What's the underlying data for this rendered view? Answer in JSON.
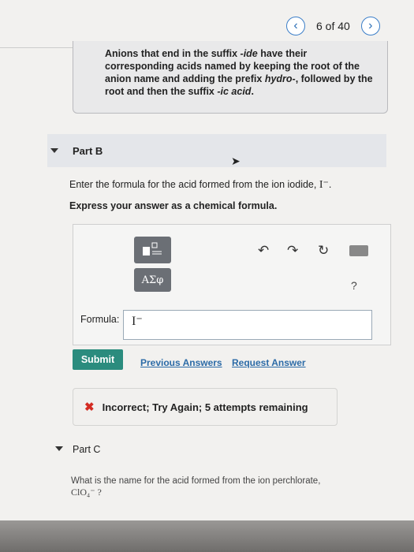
{
  "nav": {
    "prev_label": "‹",
    "next_label": "›",
    "position": "6 of 40"
  },
  "hint": {
    "text_a": "Anions that end in the suffix ",
    "text_b": "-ide",
    "text_c": " have their corresponding acids named by keeping the root of the anion name and adding the prefix ",
    "text_d": "hydro-",
    "text_e": ", followed by the root and then the suffix ",
    "text_f": "-ic acid",
    "text_g": "."
  },
  "part_b": {
    "title": "Part B",
    "question": "Enter the formula for the acid formed from the ion iodide, ",
    "ion": "I⁻",
    "question_end": ".",
    "instruction": "Express your answer as a chemical formula."
  },
  "toolbar": {
    "greek_label": "ΑΣφ",
    "undo": "↶",
    "redo": "↷",
    "reset": "↻",
    "help": "?"
  },
  "answer": {
    "label": "Formula:",
    "value": "I⁻"
  },
  "actions": {
    "submit": "Submit",
    "previous_answers": "Previous Answers",
    "request_answer": "Request Answer"
  },
  "feedback": {
    "icon": "✖",
    "text": "Incorrect; Try Again; 5 attempts remaining"
  },
  "part_c": {
    "title": "Part C",
    "question": "What is the name for the acid formed from the ion perchlorate,",
    "ion": "ClO₄⁻ ?"
  },
  "colors": {
    "accent": "#2b8c7e",
    "link": "#2c6ba7",
    "error": "#d32b22"
  }
}
